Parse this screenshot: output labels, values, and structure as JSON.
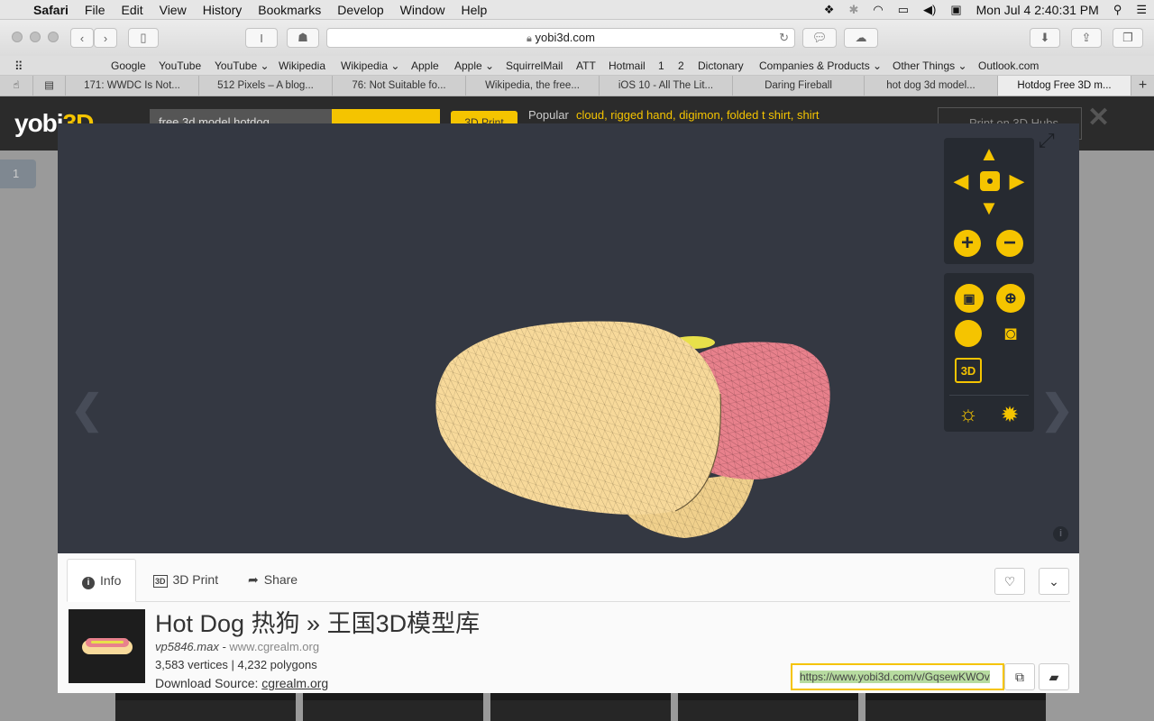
{
  "menubar": {
    "app": "Safari",
    "items": [
      "File",
      "Edit",
      "View",
      "History",
      "Bookmarks",
      "Develop",
      "Window",
      "Help"
    ],
    "clock": "Mon Jul 4  2:40:31 PM"
  },
  "toolbar": {
    "url": "yobi3d.com",
    "reader_icon": "I"
  },
  "bookmarks": [
    "Google",
    "YouTube",
    "YouTube ⌄",
    "Wikipedia",
    "Wikipedia ⌄",
    "Apple",
    "Apple ⌄",
    "SquirrelMail",
    "ATT",
    "Hotmail",
    "1",
    "2",
    "Dictonary",
    "Companies & Products ⌄",
    "Other Things ⌄",
    "Outlook.com"
  ],
  "tabs": [
    "171: WWDC Is Not...",
    "512 Pixels – A blog...",
    "76: Not Suitable fo...",
    "Wikipedia, the free...",
    "iOS 10 - All The Lit...",
    "Daring Fireball",
    "hot dog 3d model...",
    "Hotdog Free 3D m..."
  ],
  "site": {
    "logo_main": "yobi",
    "logo_accent": "3D",
    "search_value": "free 3d model hotdog",
    "print_button": "3D Print",
    "popular_label": "Popular",
    "popular_items": "cloud, rigged hand, digimon, folded t shirt, shirt",
    "hubs_button": "Print on 3D Hubs",
    "page_number": "1"
  },
  "viewer": {
    "prev": "❮",
    "next": "❯",
    "info": "i",
    "expand": "⤢",
    "zoom_in": "+",
    "zoom_out": "−",
    "cube_label": "3D"
  },
  "info": {
    "tab_info": "Info",
    "tab_print": "3D Print",
    "tab_share": "Share",
    "title": "Hot Dog 热狗 » 王国3D模型库",
    "file": "vp5846.max -",
    "file_site": "www.cgrealm.org",
    "stats": "3,583 vertices | 4,232 polygons",
    "source_label": "Download Source:",
    "source_link": "cgrealm.org",
    "share_url": "https://www.yobi3d.com/v/GqsewKWOv"
  },
  "colors": {
    "accent": "#f5c400",
    "viewer_bg": "#343842",
    "bun": "#f7d99a",
    "sausage": "#e8818c"
  }
}
